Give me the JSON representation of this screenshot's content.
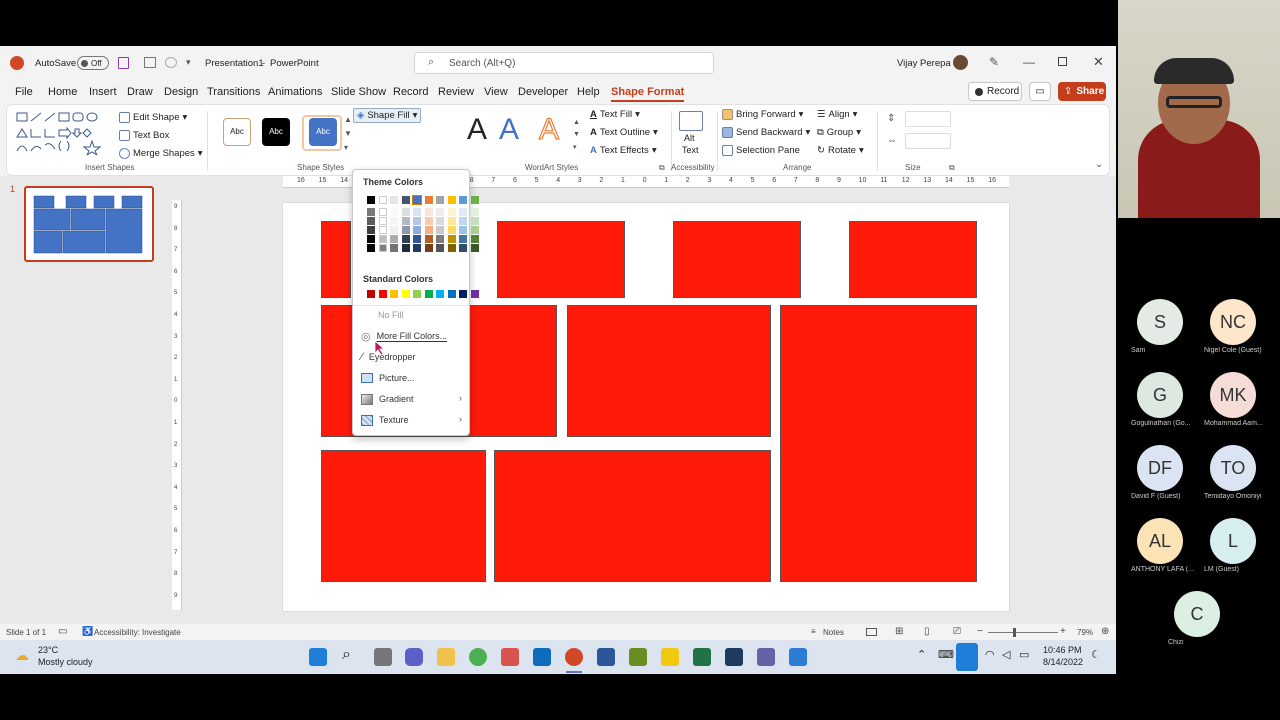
{
  "titlebar": {
    "autosave_label": "AutoSave",
    "autosave_state": "Off",
    "doc_title": "Presentation1",
    "separator": "-",
    "app_name": "PowerPoint",
    "search_placeholder": "Search (Alt+Q)",
    "user_name": "Vijay Perepa",
    "window_controls": [
      "minimize-icon",
      "restore-icon",
      "close-icon"
    ]
  },
  "menu": {
    "tabs": [
      "File",
      "Home",
      "Insert",
      "Draw",
      "Design",
      "Transitions",
      "Animations",
      "Slide Show",
      "Record",
      "Review",
      "View",
      "Developer",
      "Help",
      "Shape Format"
    ],
    "active_tab": "Shape Format",
    "record_label": "Record",
    "share_label": "Share"
  },
  "ribbon": {
    "insert_shapes": {
      "edit_shape": "Edit Shape",
      "text_box": "Text Box",
      "merge_shapes": "Merge Shapes",
      "group_label": "Insert Shapes"
    },
    "shape_styles": {
      "style_label": "Abc",
      "shape_fill": "Shape Fill",
      "group_label": "Shape Styles"
    },
    "wordart": {
      "text_fill": "Text Fill",
      "text_outline": "Text Outline",
      "text_effects": "Text Effects",
      "group_label": "WordArt Styles",
      "sample_letter": "A"
    },
    "accessibility": {
      "alt_text_line1": "Alt",
      "alt_text_line2": "Text",
      "group_label": "Accessibility"
    },
    "arrange": {
      "bring_forward": "Bring Forward",
      "send_backward": "Send Backward",
      "selection_pane": "Selection Pane",
      "align": "Align",
      "group": "Group",
      "rotate": "Rotate",
      "group_label": "Arrange"
    },
    "size": {
      "group_label": "Size"
    }
  },
  "ruler": {
    "ticks": [
      "16",
      "15",
      "14",
      "13",
      "12",
      "11",
      "10",
      "9",
      "8",
      "7",
      "6",
      "5",
      "4",
      "3",
      "2",
      "1",
      "0",
      "1",
      "2",
      "3",
      "4",
      "5",
      "6",
      "7",
      "8",
      "9",
      "10",
      "11",
      "12",
      "13",
      "14",
      "15",
      "16"
    ],
    "vticks": [
      "9",
      "8",
      "7",
      "6",
      "5",
      "4",
      "3",
      "2",
      "1",
      "0",
      "1",
      "2",
      "3",
      "4",
      "5",
      "6",
      "7",
      "8",
      "9"
    ]
  },
  "thumbnails": {
    "slide_number": "1"
  },
  "dropdown": {
    "theme_colors_title": "Theme Colors",
    "standard_colors_title": "Standard Colors",
    "theme_colors": [
      "#000000",
      "#ffffff",
      "#e7e6e6",
      "#44546a",
      "#4472c4",
      "#ed7d31",
      "#a5a5a5",
      "#ffc000",
      "#5b9bd5",
      "#70ad47"
    ],
    "standard_colors": [
      "#c00000",
      "#ff0000",
      "#ffc000",
      "#ffff00",
      "#92d050",
      "#00b050",
      "#00b0f0",
      "#0070c0",
      "#002060",
      "#7030a0"
    ],
    "items": [
      {
        "label": "No Fill",
        "icon": "no-fill-icon",
        "disabled": true
      },
      {
        "label": "More Fill Colors...",
        "icon": "palette-icon",
        "disabled": false
      },
      {
        "label": "Eyedropper",
        "icon": "eyedropper-icon",
        "disabled": false
      },
      {
        "label": "Picture...",
        "icon": "picture-icon",
        "disabled": false
      },
      {
        "label": "Gradient",
        "icon": "gradient-icon",
        "disabled": false
      },
      {
        "label": "Texture",
        "icon": "texture-icon",
        "disabled": false
      }
    ]
  },
  "statusbar": {
    "slide_info": "Slide 1 of 1",
    "accessibility": "Accessibility: Investigate",
    "notes": "Notes",
    "zoom": "79%"
  },
  "taskbar": {
    "temperature": "23°C",
    "weather": "Mostly cloudy",
    "time": "10:46 PM",
    "date": "8/14/2022"
  },
  "participants": [
    {
      "initials": "S",
      "name": "Sam",
      "color": "#e4ebe4"
    },
    {
      "initials": "NC",
      "name": "Nigel Cole (Guest)",
      "color": "#fde6c9"
    },
    {
      "initials": "G",
      "name": "Gogulnathan (Go...",
      "color": "#dde9e0"
    },
    {
      "initials": "MK",
      "name": "Mohammad Aam...",
      "color": "#f6dcd6"
    },
    {
      "initials": "DF",
      "name": "David F (Guest)",
      "color": "#dbe4f3"
    },
    {
      "initials": "TO",
      "name": "Temidayo Omoniyi",
      "color": "#dbe4f3"
    },
    {
      "initials": "AL",
      "name": "ANTHONY LAFA (...",
      "color": "#fbe3b6"
    },
    {
      "initials": "L",
      "name": "LM (Guest)",
      "color": "#d7eef0"
    },
    {
      "initials": "C",
      "name": "Chizi",
      "color": "#dcefe3"
    }
  ]
}
